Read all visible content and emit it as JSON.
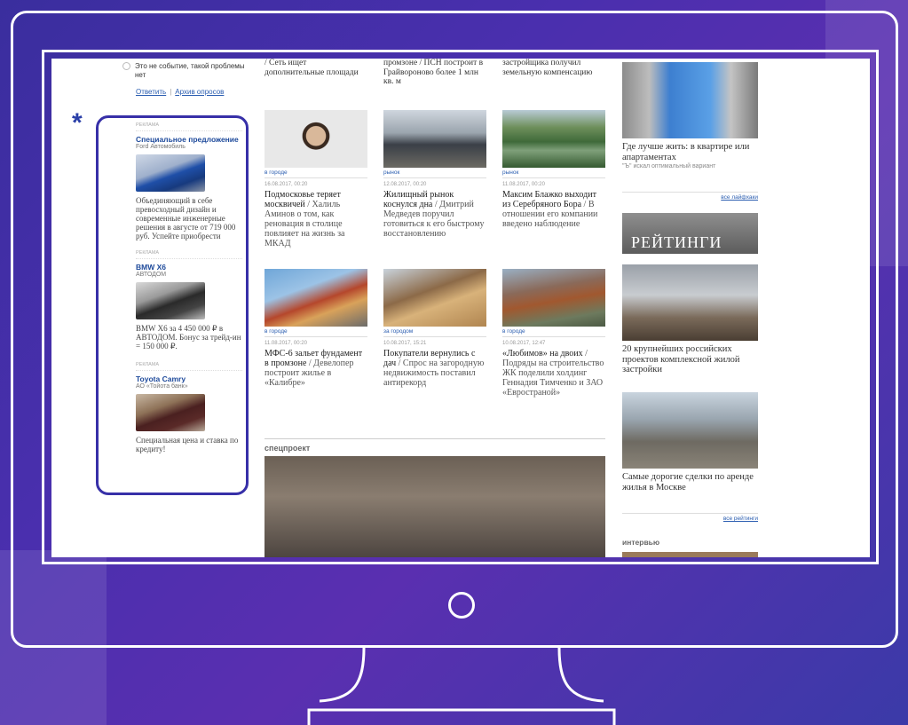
{
  "poll": {
    "option": "Это не событие, такой проблемы нет",
    "answer_link": "Ответить",
    "archive_link": "Архив опросов"
  },
  "ads": [
    {
      "tag": "РЕКЛАМА",
      "title": "Специальное предложение",
      "advertiser": "Ford Автомобиль",
      "text": "Объединяющий в себе превосходный дизайн и современные инженерные решения в августе от 719 000 руб. Успейте приобрести"
    },
    {
      "tag": "РЕКЛАМА",
      "title": "BMW X6",
      "advertiser": "АВТОДОМ",
      "text": "BMW X6 за 4 450 000 ₽ в АВТОДОМ. Бонус за трейд-ин = 150 000 ₽."
    },
    {
      "tag": "РЕКЛАМА",
      "title": "Toyota Camry",
      "advertiser": "АО «Тойота банк»",
      "text": "Специальная цена и ставка по кредиту!"
    }
  ],
  "top_fragments": [
    "/ Сеть ищет дополнительные площади",
    "промзоне / ПСН построит в Грайвороново более 1 млн кв. м",
    "застройщика получил земельную компенсацию"
  ],
  "news": [
    {
      "category": "в городе",
      "date": "16.08.2017, 00:20",
      "title": "Подмосковье теряет москвичей",
      "rest": " / Халиль Аминов о том, как реновация в столице повлияет на жизнь за МКАД"
    },
    {
      "category": "рынок",
      "date": "12.08.2017, 00:20",
      "title": "Жилищный рынок коснулся дна",
      "rest": " / Дмитрий Медведев поручил готовиться к его быстрому восстановлению"
    },
    {
      "category": "рынок",
      "date": "11.08.2017, 00:20",
      "title": "Максим Блажко выходит из Серебряного Бора",
      "rest": " / В отношении его компании введено наблюдение"
    },
    {
      "category": "в городе",
      "date": "11.08.2017, 00:20",
      "title": "МФС-6 зальет фундамент в промзоне",
      "rest": " / Девелопер построит жилье в «Калибре»"
    },
    {
      "category": "за городом",
      "date": "10.08.2017, 15:21",
      "title": "Покупатели вернулись с дач",
      "rest": " / Спрос на загородную недвижимость поставил антирекорд"
    },
    {
      "category": "в городе",
      "date": "10.08.2017, 12:47",
      "title": "«Любимов» на двоих",
      "rest": " / Подряды на строительство ЖК поделили холдинг Геннадия Тимченко и ЗАО «Евространой»"
    }
  ],
  "special_project_label": "спецпроект",
  "right": {
    "lifehack_title": "Где лучше жить: в квартире или апартаментах",
    "lifehack_sub": "\"Ъ\" искал оптимальный вариант",
    "all_lifehacks": "все лайфхаки",
    "ratings_banner": "РЕЙТИНГИ",
    "rating1": "20 крупнейших российских проектов комплексной жилой застройки",
    "rating2": "Самые дорогие сделки по аренде жилья в Москве",
    "all_ratings": "все рейтинги",
    "interview_label": "интервью"
  },
  "colors": {
    "frame": "#ffffff",
    "ad_border": "#3730a8",
    "link": "#2a5db0",
    "background": "#4a2fae"
  }
}
